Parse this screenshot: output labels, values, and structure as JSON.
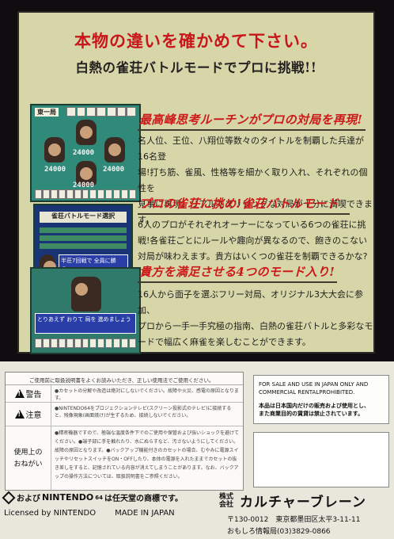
{
  "headline": "本物の違いを確かめて下さい。",
  "subheadline": "白熱の雀荘バトルモードでプロに挑戦!!",
  "shot1": {
    "label": "東一局",
    "scores": [
      "24000",
      "24000",
      "24000",
      "24000"
    ]
  },
  "shot2": {
    "menu_title": "雀荘バトルモード選択",
    "message": "半荘7回戦で 全員に勝つ..."
  },
  "shot3": {
    "message": "とりあえず おりて 局を 進めましょう"
  },
  "features": [
    {
      "title": "最高峰思考ルーチンがプロの対局を再現!",
      "lines": [
        "名人位、王位、八翔位等数々のタイトルを制覇した兵達が16名登",
        "場!打ち筋、雀風、性格等を細かく取り入れ、それぞれの個性を",
        "見事に再現。リアルでスリリングな対局が十分に満喫できます。"
      ]
    },
    {
      "title": "プロの雀荘に挑め!雀荘バトルモード",
      "lines": [
        "6人のプロがそれぞれオーナーになっている6つの雀荘に挑",
        "戦!各雀荘ごとにルールや趣向が異なるので、飽きのこない",
        "対局が味わえます。貴方はいくつの雀荘を制覇できるかな?"
      ]
    },
    {
      "title": "貴方を満足させる4つのモード入り!",
      "lines": [
        "16人から面子を選ぶフリー対局、オリジナル3大大会に参加、",
        "プロから一手一手究極の指南、白熱の雀荘バトルと多彩なモ",
        "ードで幅広く麻雀を楽しむことができます。"
      ]
    }
  ],
  "warning": {
    "intro": "ご使用前に取扱説明書をよくお読みいただき、正しい使用法でご使用ください。",
    "rows": [
      {
        "label": "警告",
        "text": "●カセットの分解や改造は絶対にしないでください。故障や火災、感電の原因となります。"
      },
      {
        "label": "注意",
        "text": "●NINTENDO64をプロジェクションテレビ(スクリーン投影式のテレビ)に接続すると、残像現象(画面焼け)が生ずるため、接続しないでください。"
      },
      {
        "label_lines": [
          "使用上の",
          "おねがい"
        ],
        "text": "●精密機器ですので、極端な温度条件下でのご使用や保管および強いショックを避けてください。●端子部に手を触れたり、水にぬらすなど、汚さないようにしてください。故障の原因となります。●バックアップ機能付きのカセットの場合、むやみに電源スイッチやリセットスイッチをON・OFFしたり、本体の電源を入れたままでカセットの抜き差しをすると、記憶されている内容が消えてしまうことがあります。なお、バックアップの操作方法については、取扱説明書をご参照ください。"
      }
    ]
  },
  "sale": {
    "en_lines": [
      "FOR SALE AND USE IN JAPAN ONLY AND",
      "COMMERCIAL RENTALPROHIBITED."
    ],
    "ja_lines": [
      "本品は日本国内だけの販売および使用とし、",
      "また商業目的の賃貸は禁止されています。"
    ]
  },
  "trademark": {
    "pre": "および",
    "brand": "NINTENDO",
    "sup": "64",
    "post": "は任天堂の商標です。"
  },
  "licensed": {
    "left": "Licensed by NINTENDO",
    "right": "MADE IN JAPAN"
  },
  "company": {
    "kabu": "株式会社",
    "name": "カルチャーブレーン"
  },
  "address": "〒130-0012　東京都墨田区太平3-11-11",
  "phone": "おもしろ情報局(03)3829-0866"
}
